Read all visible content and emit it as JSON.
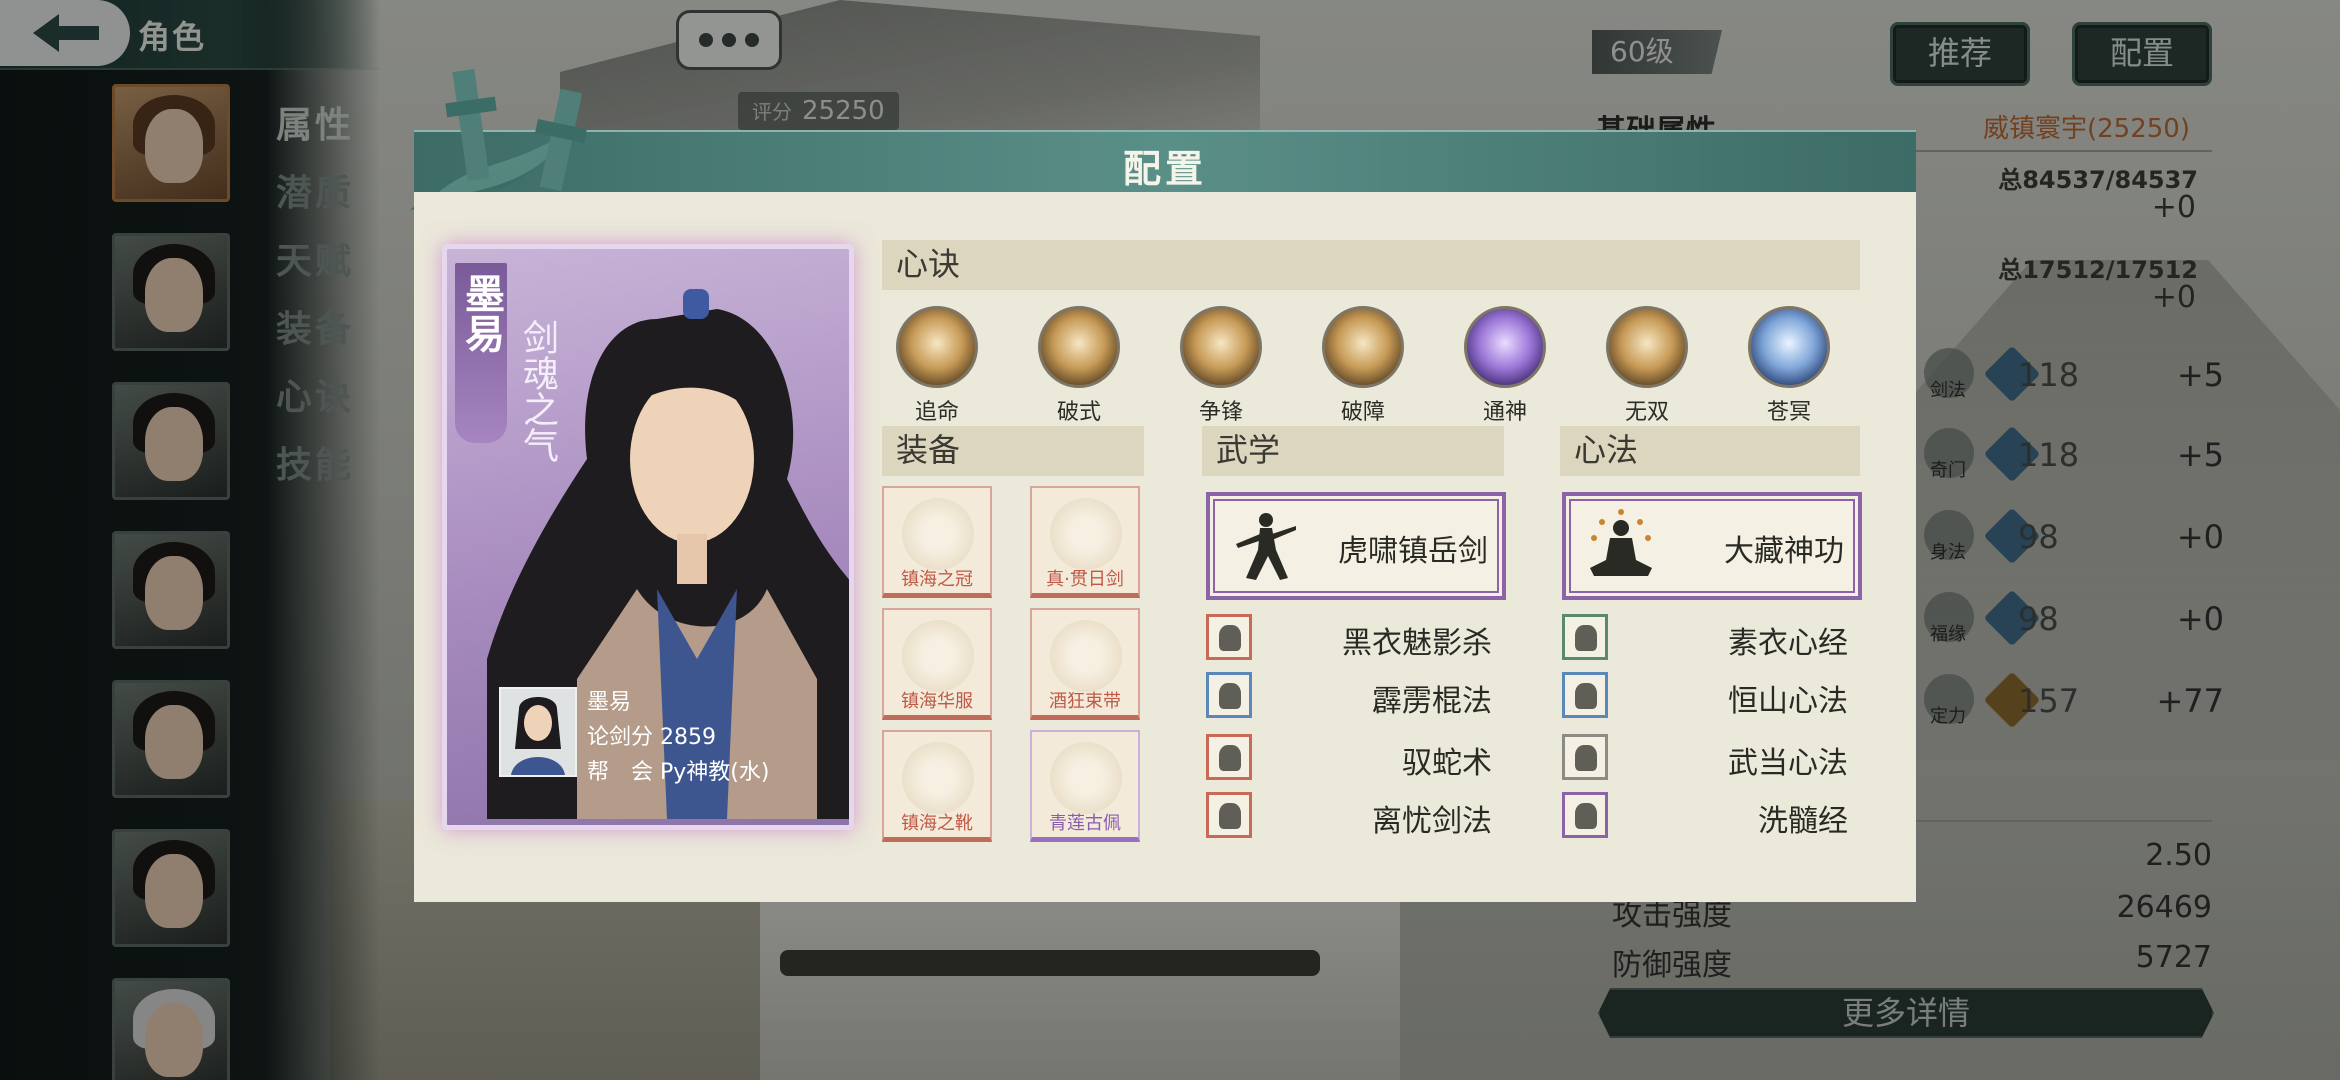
{
  "header": {
    "title": "角色"
  },
  "sidebar": {
    "tabs": [
      "属性",
      "潜质",
      "天赋",
      "装备",
      "心诀",
      "技能"
    ]
  },
  "top": {
    "score_label": "评分",
    "score_value": "25250",
    "level": "60级",
    "recommend_label": "推荐",
    "config_label": "配置"
  },
  "stats": {
    "section_title": "基础属性",
    "title_tag": "威镇寰宇(25250)",
    "hp": "总84537/84537",
    "hp_bonus": "+0",
    "mp": "总17512/17512",
    "mp_bonus": "+0",
    "attrs": [
      {
        "name": "剑法",
        "value": "118",
        "bonus": "+5"
      },
      {
        "name": "奇门",
        "value": "118",
        "bonus": "+5"
      },
      {
        "name": "身法",
        "value": "98",
        "bonus": "+0"
      },
      {
        "name": "福缘",
        "value": "98",
        "bonus": "+0"
      },
      {
        "name": "定力",
        "value": "157",
        "bonus": "+77"
      }
    ],
    "crit_value": "2.50",
    "attack_label": "攻击强度",
    "attack_value": "26469",
    "defense_label": "防御强度",
    "defense_value": "5727",
    "more_label": "更多详情"
  },
  "dialog": {
    "title": "配置",
    "character": {
      "name": "墨易",
      "subtitle": "剑魂之气",
      "info_name": "墨易",
      "info_score": "论剑分 2859",
      "info_guild": "帮　会 Py神教(水)"
    },
    "xinjue_title": "心诀",
    "xinjue": [
      "追命",
      "破式",
      "争锋",
      "破障",
      "通神",
      "无双",
      "苍冥"
    ],
    "equip_title": "装备",
    "equipment": [
      "镇海之冠",
      "真·贯日剑",
      "镇海华服",
      "酒狂束带",
      "镇海之靴",
      "青莲古佩"
    ],
    "wuxue_title": "武学",
    "wuxue_main": "虎啸镇岳剑",
    "wuxue_list": [
      "黑衣魅影杀",
      "霹雳棍法",
      "驭蛇术",
      "离忧剑法"
    ],
    "xinfa_title": "心法",
    "xinfa_main": "大藏神功",
    "xinfa_list": [
      "素衣心经",
      "恒山心法",
      "武当心法",
      "洗髓经"
    ]
  },
  "colors": {
    "dialog_header": "#4f837c",
    "dialog_body": "#ebe9da",
    "card_purple": "#a78bbf",
    "equip_red": "#c16c5b",
    "equip_purple": "#9a6ec1",
    "title_orange": "#b86a32"
  }
}
